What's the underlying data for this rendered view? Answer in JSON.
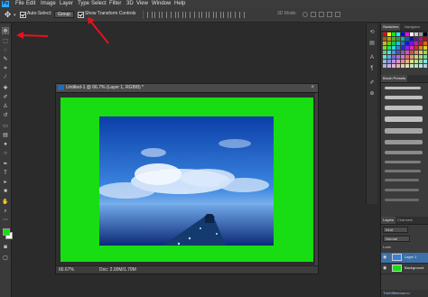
{
  "menu": {
    "logo": "Ps",
    "items": [
      "File",
      "Edit",
      "Image",
      "Layer",
      "Type",
      "Select",
      "Filter",
      "3D",
      "View",
      "Window",
      "Help"
    ]
  },
  "options": {
    "tool_icon": "move-tool",
    "auto_select_label": "Auto-Select:",
    "auto_select_value": "Group",
    "show_transform_label": "Show Transform Controls",
    "mode_3d_label": "3D Mode:"
  },
  "document": {
    "title": "Untitled-1 @ 66.7% (Layer 1, RGB/8) *",
    "close": "×",
    "zoom": "66.67%",
    "doc_size": "Doc: 2.00M/1.79M",
    "canvas_color": "#17dd12"
  },
  "panels": {
    "swatches_tabs": [
      "Swatches",
      "Navigator"
    ],
    "brush_tab": "Brush Presets",
    "layers_tabs": [
      "Layers",
      "Channels"
    ],
    "kind_label": "Kind",
    "blend_mode": "Normal",
    "lock_label": "Lock:",
    "layers": [
      {
        "name": "Layer 1",
        "selected": true
      },
      {
        "name": "Background",
        "selected": false
      }
    ]
  },
  "watermark": "TheDifference.ru",
  "colors": {
    "accent": "#31a8ff",
    "annotation_red": "#e8111f",
    "green": "#17dd12",
    "selected_layer": "#3d6fa8"
  }
}
